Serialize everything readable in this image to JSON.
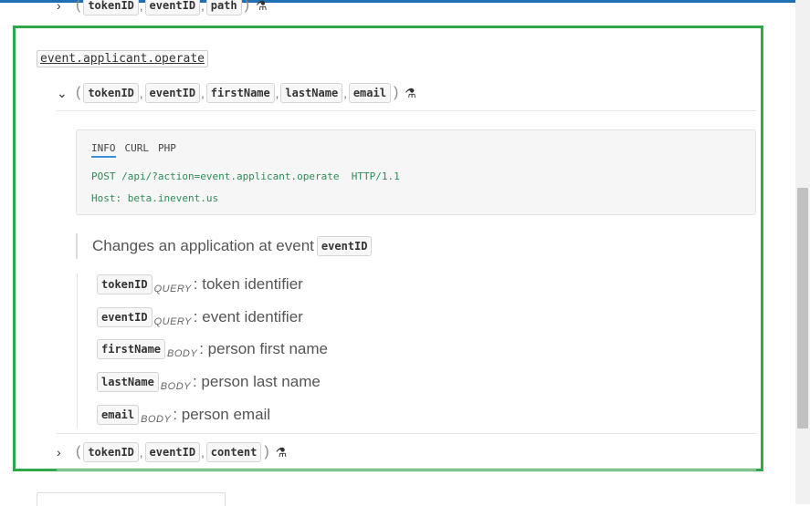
{
  "top_row": {
    "chevron": "›",
    "params": [
      "tokenID",
      "eventID",
      "path"
    ]
  },
  "endpoint": {
    "name": "event.applicant.operate",
    "params": [
      "tokenID",
      "eventID",
      "firstName",
      "lastName",
      "email"
    ],
    "chevron": "⌄",
    "tabs": [
      "INFO",
      "CURL",
      "PHP"
    ],
    "active_tab": "INFO",
    "code_lines": [
      "POST /api/?action=event.applicant.operate  HTTP/1.1",
      "Host: beta.inevent.us"
    ],
    "description_text": "Changes an application at event",
    "description_code": "eventID",
    "parameters": [
      {
        "name": "tokenID",
        "location": "QUERY",
        "description": ": token identifier"
      },
      {
        "name": "eventID",
        "location": "QUERY",
        "description": ": event identifier"
      },
      {
        "name": "firstName",
        "location": "BODY",
        "description": ": person first name"
      },
      {
        "name": "lastName",
        "location": "BODY",
        "description": ": person last name"
      },
      {
        "name": "email",
        "location": "BODY",
        "description": ": person email"
      }
    ]
  },
  "bottom_row": {
    "chevron": "›",
    "params": [
      "tokenID",
      "eventID",
      "content"
    ]
  },
  "symbols": {
    "open_paren": "(",
    "close_paren": ")",
    "comma": ",",
    "flask": "⚗"
  },
  "colors": {
    "frame": "#2ea84a",
    "code_text": "#2e8b57",
    "tab_active": "#3a8fd8",
    "top_bar": "#1f6fb2"
  },
  "icons": {
    "expand": "chevron-right-icon",
    "collapse": "chevron-down-icon",
    "try": "flask-icon"
  }
}
